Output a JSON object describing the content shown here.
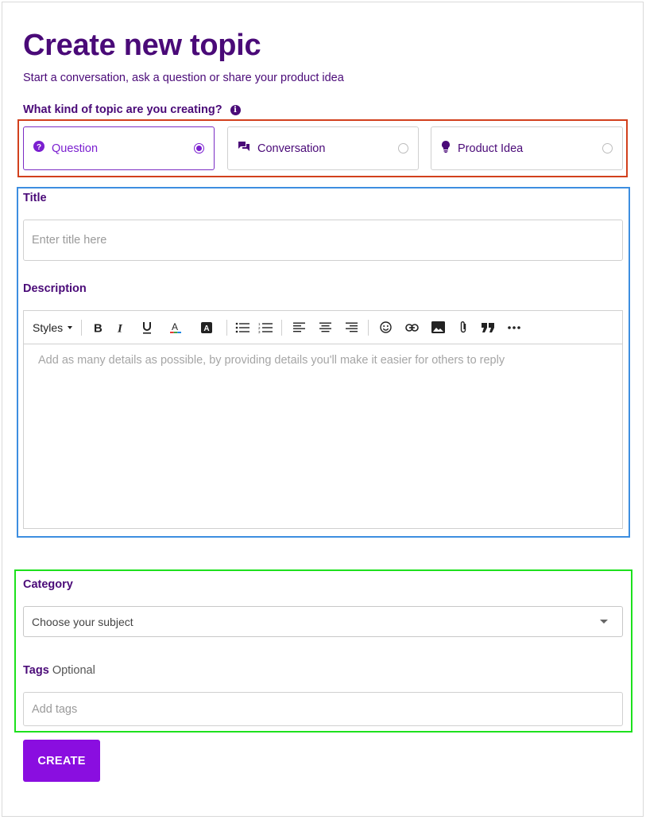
{
  "page": {
    "title": "Create new topic",
    "subtitle": "Start a conversation, ask a question or share your product idea"
  },
  "topic_kind": {
    "label": "What kind of topic are you creating?",
    "options": [
      {
        "label": "Question",
        "icon": "question-circle-icon",
        "selected": true
      },
      {
        "label": "Conversation",
        "icon": "chat-bubbles-icon",
        "selected": false
      },
      {
        "label": "Product Idea",
        "icon": "lightbulb-icon",
        "selected": false
      }
    ]
  },
  "title_field": {
    "label": "Title",
    "placeholder": "Enter title here"
  },
  "description": {
    "label": "Description",
    "placeholder": "Add as many details as possible, by providing details you'll make it easier for others to reply",
    "toolbar": {
      "styles_label": "Styles",
      "buttons": [
        "bold-icon",
        "italic-icon",
        "underline-icon",
        "text-color-icon",
        "background-color-icon",
        "bulleted-list-icon",
        "numbered-list-icon",
        "align-left-icon",
        "align-center-icon",
        "align-right-icon",
        "emoji-icon",
        "link-icon",
        "image-icon",
        "attachment-icon",
        "blockquote-icon",
        "more-icon"
      ]
    }
  },
  "category": {
    "label": "Category",
    "placeholder": "Choose your subject"
  },
  "tags": {
    "label": "Tags",
    "optional": "Optional",
    "placeholder": "Add tags"
  },
  "actions": {
    "create_label": "CREATE"
  },
  "colors": {
    "primary": "#8a0ee0",
    "heading": "#4a0a78",
    "annotation_red": "#d2401d",
    "annotation_blue": "#3d8ee0",
    "annotation_green": "#1de11d"
  }
}
